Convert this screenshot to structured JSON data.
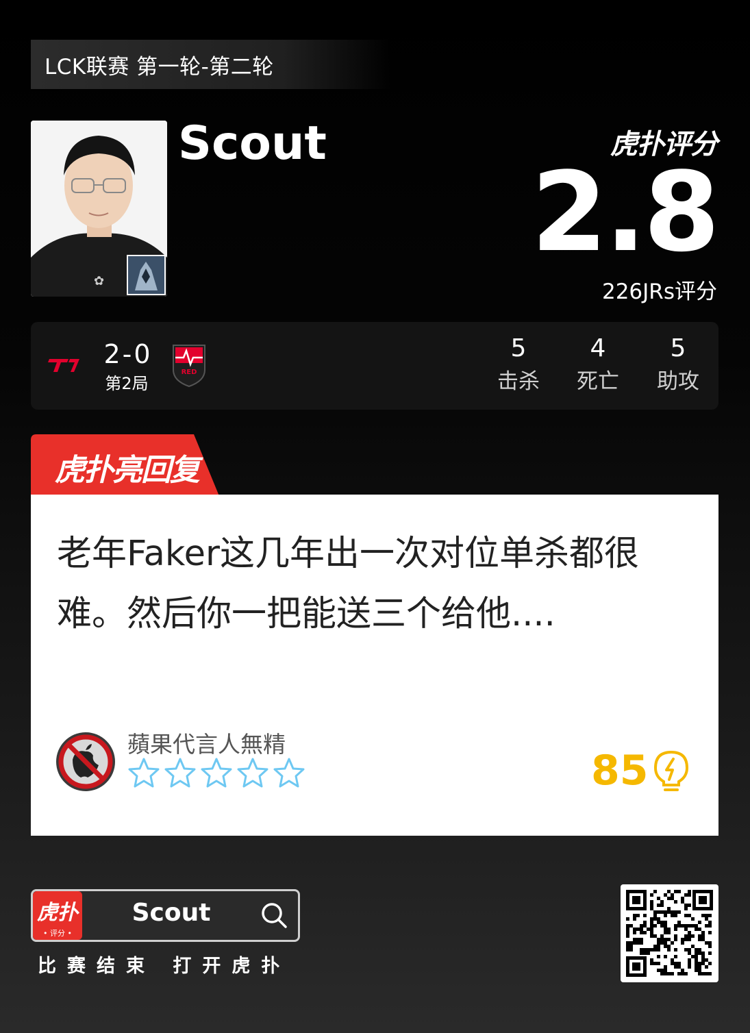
{
  "league": {
    "title": "LCK联赛 第一轮-第二轮"
  },
  "player": {
    "name": "Scout"
  },
  "rating": {
    "brand": "虎扑评分",
    "score": "2.8",
    "count_label": "226JRs评分"
  },
  "match": {
    "score": "2-0",
    "game": "第2局",
    "left_team_logo": "t1-logo",
    "right_team_logo": "red-force-logo",
    "stats": [
      {
        "value": "5",
        "label": "击杀"
      },
      {
        "value": "4",
        "label": "死亡"
      },
      {
        "value": "5",
        "label": "助攻"
      }
    ]
  },
  "highlight": {
    "tab_label": "虎扑亮回复",
    "comment": "老年Faker这几年出一次对位单杀都很难。然后你一把能送三个给他....",
    "username": "蘋果代言人無精",
    "stars": 0,
    "likes": "85"
  },
  "footer": {
    "app_icon_label": "虎扑",
    "app_icon_sub": "• 评分 •",
    "search_text": "Scout",
    "caption": "比赛结束 打开虎扑"
  },
  "colors": {
    "accent_red": "#e8302a",
    "like_yellow": "#f5b800",
    "star_blue": "#6ec8f2"
  }
}
